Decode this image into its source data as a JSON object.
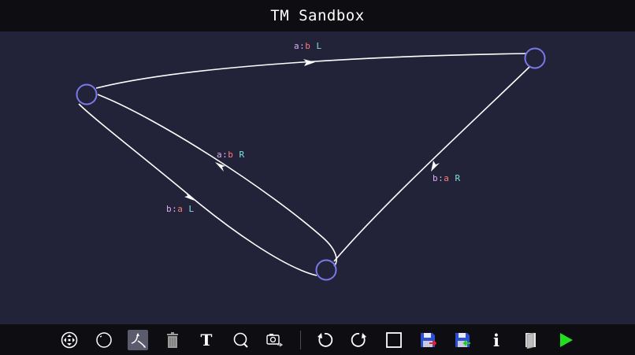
{
  "app": {
    "title": "TM Sandbox"
  },
  "colors": {
    "canvas_bg": "#222239",
    "bar_bg": "#0d0d12",
    "state_stroke": "#7b79ea",
    "edge": "#ffffff",
    "read_symbol": "#d8b0f0",
    "write_symbol": "#ff7a7a",
    "direction": "#7fe0e0",
    "play": "#22dd22"
  },
  "transitions": [
    {
      "read": "a",
      "sep": ":",
      "write": "b",
      "move": "L"
    },
    {
      "read": "a",
      "sep": ":",
      "write": "b",
      "move": "R"
    },
    {
      "read": "b",
      "sep": ":",
      "write": "a",
      "move": "R"
    },
    {
      "read": "b",
      "sep": ":",
      "write": "a",
      "move": "L"
    }
  ],
  "toolbar": {
    "tools": [
      {
        "name": "move-tool",
        "icon": "move-arrows-icon"
      },
      {
        "name": "add-state-tool",
        "icon": "circle-icon"
      },
      {
        "name": "add-transition-tool",
        "icon": "transition-arrows-icon",
        "active": true
      },
      {
        "name": "delete-tool",
        "icon": "trash-icon"
      },
      {
        "name": "text-tool",
        "icon": "text-icon",
        "label": "T"
      },
      {
        "name": "zoom-tool",
        "icon": "zoom-icon"
      },
      {
        "name": "screenshot-tool",
        "icon": "camera-icon"
      },
      {
        "name": "undo-button",
        "icon": "undo-icon"
      },
      {
        "name": "redo-button",
        "icon": "redo-icon"
      },
      {
        "name": "frame-button",
        "icon": "square-frame-icon"
      },
      {
        "name": "save-red-button",
        "icon": "save-disk-red-icon"
      },
      {
        "name": "save-green-button",
        "icon": "save-disk-green-icon"
      },
      {
        "name": "info-button",
        "icon": "info-icon",
        "label": "i"
      },
      {
        "name": "open-book-button",
        "icon": "book-icon"
      },
      {
        "name": "run-button",
        "icon": "play-icon"
      }
    ]
  }
}
